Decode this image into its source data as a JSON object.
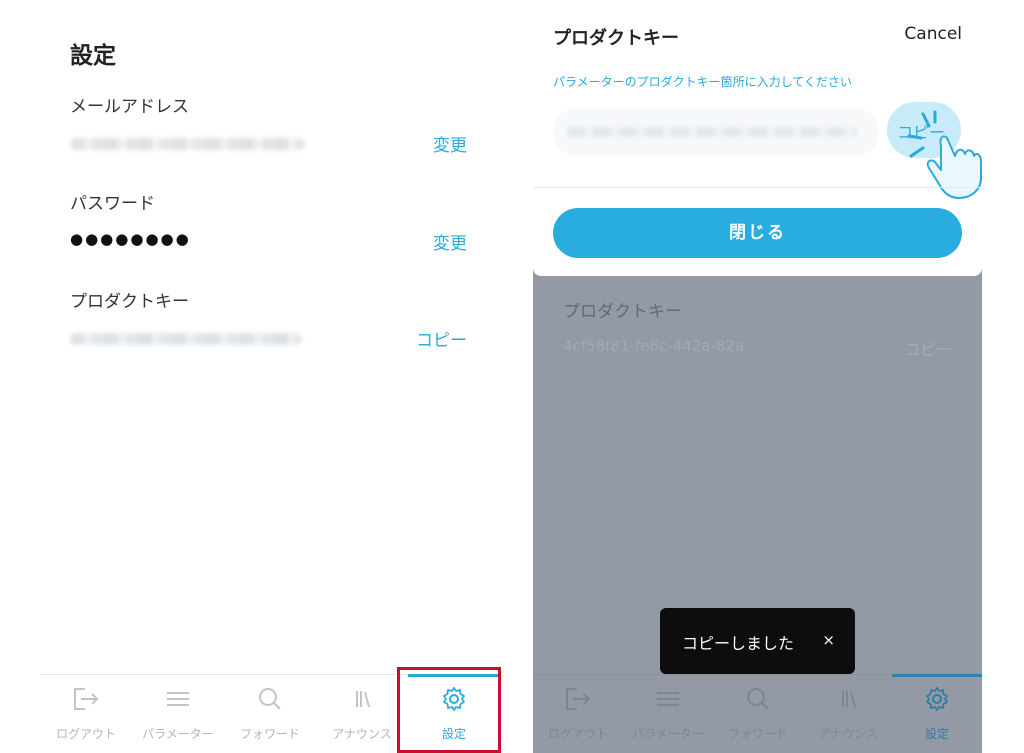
{
  "left": {
    "title": "設定",
    "email": {
      "label": "メールアドレス",
      "action": "変更"
    },
    "password": {
      "label": "パスワード",
      "value": "●●●●●●●●",
      "action": "変更"
    },
    "product_key": {
      "label": "プロダクトキー",
      "action": "コピー"
    }
  },
  "tabs": [
    {
      "id": "logout",
      "label": "ログアウト",
      "icon": "logout-icon"
    },
    {
      "id": "parameters",
      "label": "パラメーター",
      "icon": "menu-icon"
    },
    {
      "id": "forward",
      "label": "フォワード",
      "icon": "search-icon"
    },
    {
      "id": "announce",
      "label": "アナウンス",
      "icon": "books-icon"
    },
    {
      "id": "settings",
      "label": "設定",
      "icon": "gear-icon",
      "active": true
    }
  ],
  "sheet": {
    "title": "プロダクトキー",
    "cancel": "Cancel",
    "hint": "パラメーターのプロダクトキー箇所に入力してください",
    "copy": "コピー",
    "close": "閉じる"
  },
  "background": {
    "label": "プロダクトキー",
    "key": "4cf58f81-fe6c-442a-82a.",
    "copy": "コピー"
  },
  "toast": {
    "text": "コピーしました",
    "close": "×"
  },
  "colors": {
    "accent": "#29a9dc",
    "highlight": "#c8102e",
    "overlay": "#939aa5",
    "toast": "#0d0d0d"
  }
}
